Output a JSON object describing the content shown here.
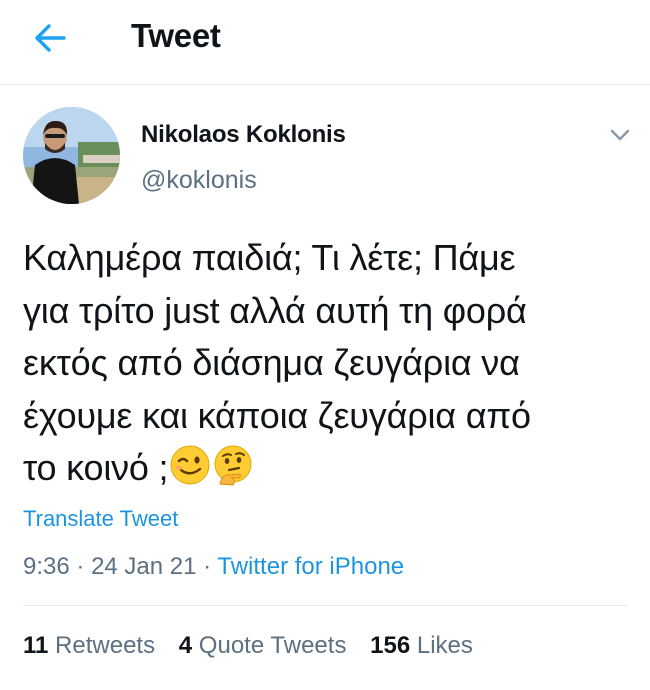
{
  "header": {
    "title": "Tweet",
    "back_icon": "arrow-left-icon",
    "accent_color": "#1da1f2"
  },
  "tweet": {
    "author": {
      "display_name": "Nikolaos Koklonis",
      "handle": "@koklonis",
      "avatar_icon": "avatar"
    },
    "text_lines": [
      "Καλημέρα παιδιά; Τι λέτε; Πάμε",
      "για τρίτο just αλλά αυτή τη φορά",
      "εκτός από διάσημα ζευγάρια να",
      "έχουμε και κάποια ζευγάρια από",
      "το κοινό ;"
    ],
    "emojis": [
      "winking-face-icon",
      "thinking-face-icon"
    ],
    "translate_label": "Translate Tweet",
    "time": "9:36",
    "date": "24 Jan 21",
    "separator": "·",
    "source": "Twitter for iPhone",
    "link_color": "#1b95e0"
  },
  "stats": {
    "retweets_count": "11",
    "retweets_label": "Retweets",
    "quotes_count": "4",
    "quotes_label": "Quote Tweets",
    "likes_count": "156",
    "likes_label": "Likes"
  }
}
